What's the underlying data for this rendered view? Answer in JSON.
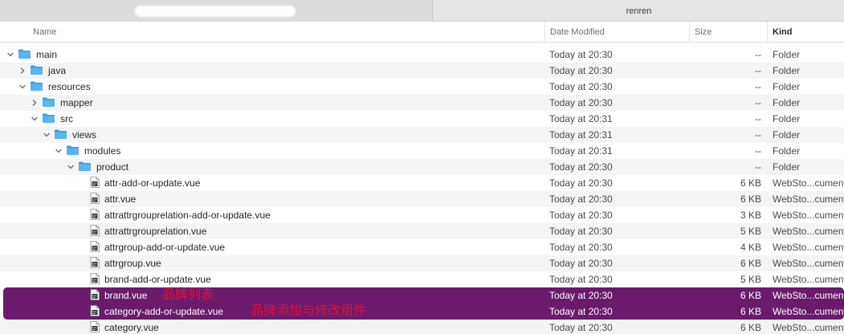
{
  "tabs": [
    {
      "label": ""
    },
    {
      "label": "renren"
    }
  ],
  "columns": {
    "name": "Name",
    "date": "Date Modified",
    "size": "Size",
    "kind": "Kind"
  },
  "rows": [
    {
      "name": "main",
      "type": "folder",
      "depth": 0,
      "chevron": "down",
      "date": "Today at 20:30",
      "size": "--",
      "kind": "Folder"
    },
    {
      "name": "java",
      "type": "folder",
      "depth": 1,
      "chevron": "right",
      "date": "Today at 20:30",
      "size": "--",
      "kind": "Folder"
    },
    {
      "name": "resources",
      "type": "folder",
      "depth": 1,
      "chevron": "down",
      "date": "Today at 20:30",
      "size": "--",
      "kind": "Folder"
    },
    {
      "name": "mapper",
      "type": "folder",
      "depth": 2,
      "chevron": "right",
      "date": "Today at 20:30",
      "size": "--",
      "kind": "Folder"
    },
    {
      "name": "src",
      "type": "folder",
      "depth": 2,
      "chevron": "down",
      "date": "Today at 20:31",
      "size": "--",
      "kind": "Folder"
    },
    {
      "name": "views",
      "type": "folder",
      "depth": 3,
      "chevron": "down",
      "date": "Today at 20:31",
      "size": "--",
      "kind": "Folder"
    },
    {
      "name": "modules",
      "type": "folder",
      "depth": 4,
      "chevron": "down",
      "date": "Today at 20:31",
      "size": "--",
      "kind": "Folder"
    },
    {
      "name": "product",
      "type": "folder",
      "depth": 5,
      "chevron": "down",
      "date": "Today at 20:30",
      "size": "--",
      "kind": "Folder"
    },
    {
      "name": "attr-add-or-update.vue",
      "type": "file",
      "depth": 6,
      "date": "Today at 20:30",
      "size": "6 KB",
      "kind": "WebSto...cument"
    },
    {
      "name": "attr.vue",
      "type": "file",
      "depth": 6,
      "date": "Today at 20:30",
      "size": "6 KB",
      "kind": "WebSto...cument"
    },
    {
      "name": "attrattrgrouprelation-add-or-update.vue",
      "type": "file",
      "depth": 6,
      "date": "Today at 20:30",
      "size": "3 KB",
      "kind": "WebSto...cument"
    },
    {
      "name": "attrattrgrouprelation.vue",
      "type": "file",
      "depth": 6,
      "date": "Today at 20:30",
      "size": "5 KB",
      "kind": "WebSto...cument"
    },
    {
      "name": "attrgroup-add-or-update.vue",
      "type": "file",
      "depth": 6,
      "date": "Today at 20:30",
      "size": "4 KB",
      "kind": "WebSto...cument"
    },
    {
      "name": "attrgroup.vue",
      "type": "file",
      "depth": 6,
      "date": "Today at 20:30",
      "size": "6 KB",
      "kind": "WebSto...cument"
    },
    {
      "name": "brand-add-or-update.vue",
      "type": "file",
      "depth": 6,
      "date": "Today at 20:30",
      "size": "5 KB",
      "kind": "WebSto...cument"
    },
    {
      "name": "brand.vue",
      "type": "file",
      "depth": 6,
      "date": "Today at 20:30",
      "size": "6 KB",
      "kind": "WebSto...cument",
      "selected": true,
      "annotation": "品牌列表"
    },
    {
      "name": "category-add-or-update.vue",
      "type": "file",
      "depth": 6,
      "date": "Today at 20:30",
      "size": "6 KB",
      "kind": "WebSto...cument",
      "selected": true,
      "annotation": "品牌添加与修改组件"
    },
    {
      "name": "category.vue",
      "type": "file",
      "depth": 6,
      "date": "Today at 20:30",
      "size": "6 KB",
      "kind": "WebSto...cument"
    }
  ],
  "colors": {
    "selection": "#6b1a6e",
    "annotation": "#e8102a",
    "folder": "#5ab4ef"
  }
}
